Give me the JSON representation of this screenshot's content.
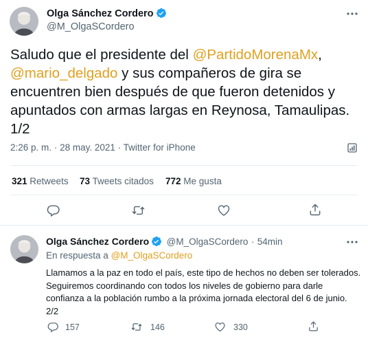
{
  "main_tweet": {
    "author_name": "Olga Sánchez Cordero",
    "author_handle": "@M_OlgaSCordero",
    "text_1": "Saludo que el presidente del ",
    "mention_1": "@PartidoMorenaMx",
    "text_2": ",",
    "mention_2": "@mario_delgado",
    "text_3": " y sus compañeros de gira se encuentren bien después de que fueron detenidos y apuntados con armas largas en Reynosa, Tamaulipas. 1/2",
    "time": "2:26 p. m.",
    "date": "28 may. 2021",
    "source": "Twitter for iPhone",
    "separator": "·"
  },
  "stats": {
    "retweets_count": "321",
    "retweets_label": "Retweets",
    "quotes_count": "73",
    "quotes_label": "Tweets citados",
    "likes_count": "772",
    "likes_label": "Me gusta"
  },
  "reply_tweet": {
    "author_name": "Olga Sánchez Cordero",
    "author_handle": "@M_OlgaSCordero",
    "age": "54min",
    "separator": "·",
    "in_reply_label": "En respuesta a ",
    "in_reply_handle": "@M_OlgaSCordero",
    "text": "Llamamos a la paz en todo el país, este tipo de hechos no deben ser tolerados. Seguiremos coordinando con todos los niveles de gobierno para darle confianza a la población rumbo a la próxima jornada electoral del 6 de junio. 2/2",
    "reply_count": "157",
    "retweet_count": "146",
    "like_count": "330"
  },
  "colors": {
    "mention": "#e0a020",
    "verified": "#1da1f2",
    "secondary_text": "#536471"
  },
  "icons": [
    "avatar",
    "verified-badge-icon",
    "more-options-icon",
    "analytics-icon",
    "reply-icon",
    "retweet-icon",
    "like-icon",
    "share-icon"
  ]
}
